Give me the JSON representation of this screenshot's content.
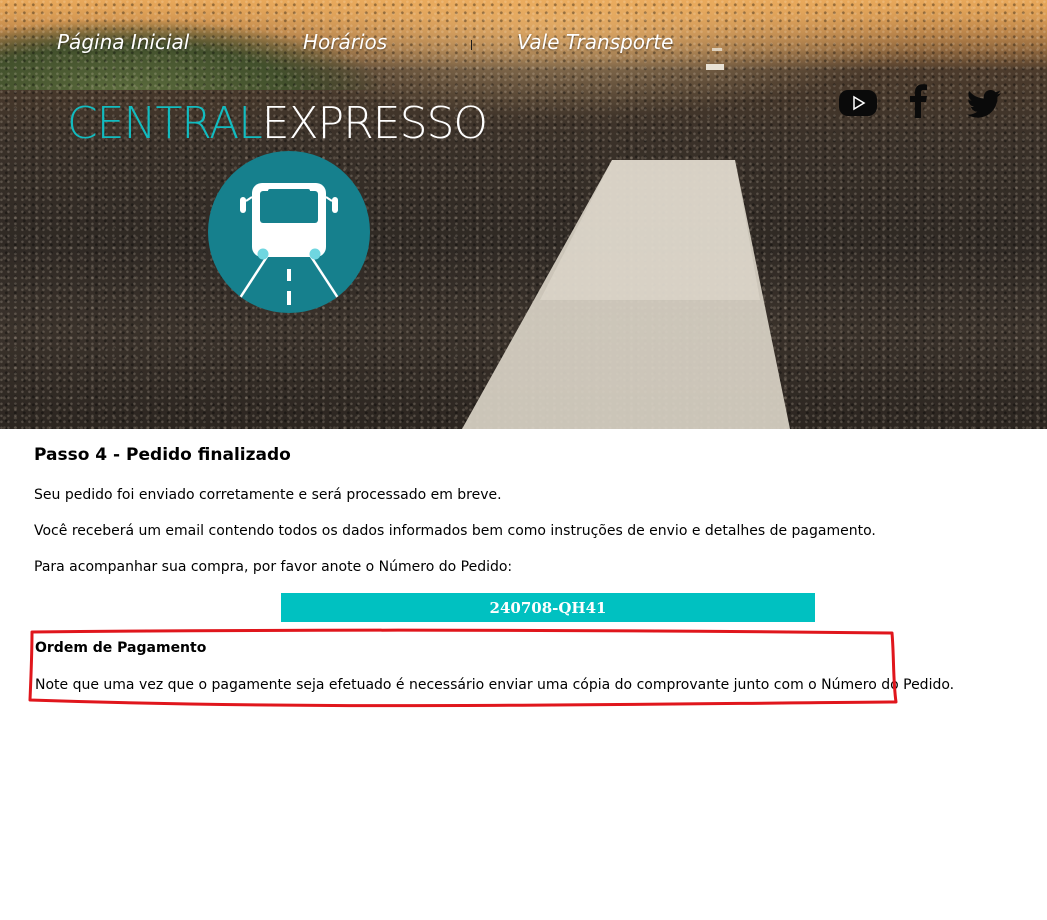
{
  "nav": {
    "home": "Página Inicial",
    "schedules": "Horários",
    "transport_voucher": "Vale Transporte"
  },
  "brand": {
    "part1": "CENTRAL",
    "part2": "EXPRESSO"
  },
  "social": {
    "icons": [
      "youtube-icon",
      "facebook-icon",
      "twitter-icon"
    ]
  },
  "colors": {
    "accent": "#12bcc0",
    "order_box": "#00c1c1",
    "logo_circle": "#16808d",
    "highlight": "#e0161c"
  },
  "main": {
    "step_title": "Passo 4 - Pedido finalizado",
    "p1": "Seu pedido foi enviado corretamente e será processado em breve.",
    "p2": "Você receberá um email contendo todos os dados informados bem como instruções de envio e detalhes de pagamento.",
    "p3": "Para acompanhar sua compra, por favor anote o Número do Pedido:",
    "order_number": "240708-QH41",
    "payment_title": "Ordem de Pagamento",
    "payment_note": "Note que uma vez que o pagamente seja efetuado é necessário enviar uma cópia do comprovante junto com o Número do Pedido."
  }
}
